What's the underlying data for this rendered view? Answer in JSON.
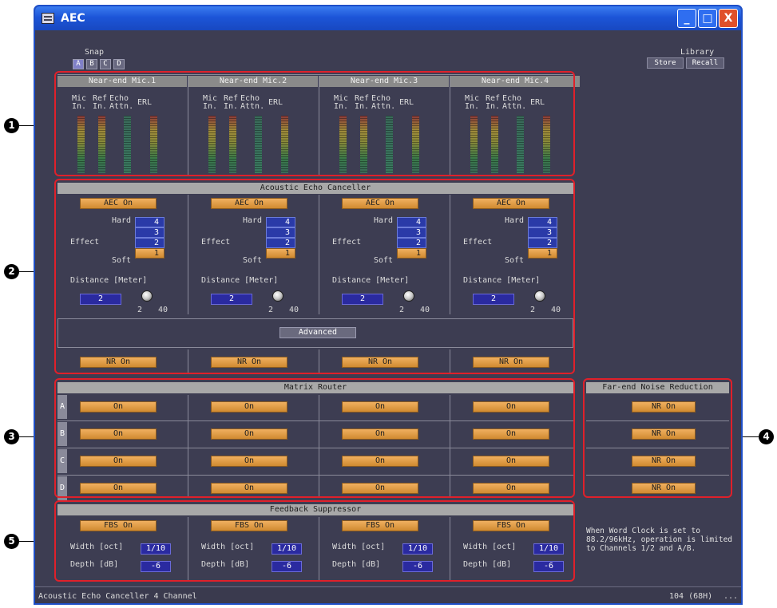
{
  "window": {
    "title": "AEC"
  },
  "title_buttons": {
    "minimize": "_",
    "maximize": "□",
    "close": "X"
  },
  "snap": {
    "label": "Snap",
    "buttons": [
      "A",
      "B",
      "C",
      "D"
    ],
    "selected": "A"
  },
  "library": {
    "label": "Library",
    "store": "Store",
    "recall": "Recall"
  },
  "mic_meters": {
    "channels": [
      "Near-end Mic.1",
      "Near-end Mic.2",
      "Near-end Mic.3",
      "Near-end Mic.4"
    ],
    "col_labels": {
      "mic_l1": "Mic",
      "mic_l2": "In.",
      "ref_l1": "Ref",
      "ref_l2": "In.",
      "echo_l1": "Echo",
      "echo_l2": "Attn.",
      "erl": "ERL"
    }
  },
  "aec": {
    "section_title": "Acoustic Echo Canceller",
    "aec_on": "AEC On",
    "hard": "Hard",
    "effect": "Effect",
    "soft": "Soft",
    "effect_levels": [
      "4",
      "3",
      "2",
      "1"
    ],
    "selected_level": "1",
    "distance_label": "Distance [Meter]",
    "distance_value": "2",
    "knob_min": "2",
    "knob_max": "40",
    "advanced": "Advanced",
    "nr_on": "NR On"
  },
  "matrix": {
    "section_title": "Matrix Router",
    "rows": [
      "A",
      "B",
      "C",
      "D"
    ],
    "on_label": "On"
  },
  "far_end": {
    "section_title": "Far-end Noise Reduction",
    "nr_on": "NR On"
  },
  "fbs": {
    "section_title": "Feedback Suppressor",
    "fbs_on": "FBS On",
    "width_label": "Width [oct]",
    "width_value": "1/10",
    "depth_label": "Depth [dB]",
    "depth_value": "-6"
  },
  "note": {
    "l1": "When Word Clock is set to",
    "l2": "88.2/96kHz, operation is limited",
    "l3": "to Channels 1/2 and A/B."
  },
  "status": {
    "left": "Acoustic Echo Canceller   4 Channel",
    "right": "104 (68H)",
    "more": "..."
  },
  "callouts": [
    "1",
    "2",
    "3",
    "4",
    "5"
  ]
}
